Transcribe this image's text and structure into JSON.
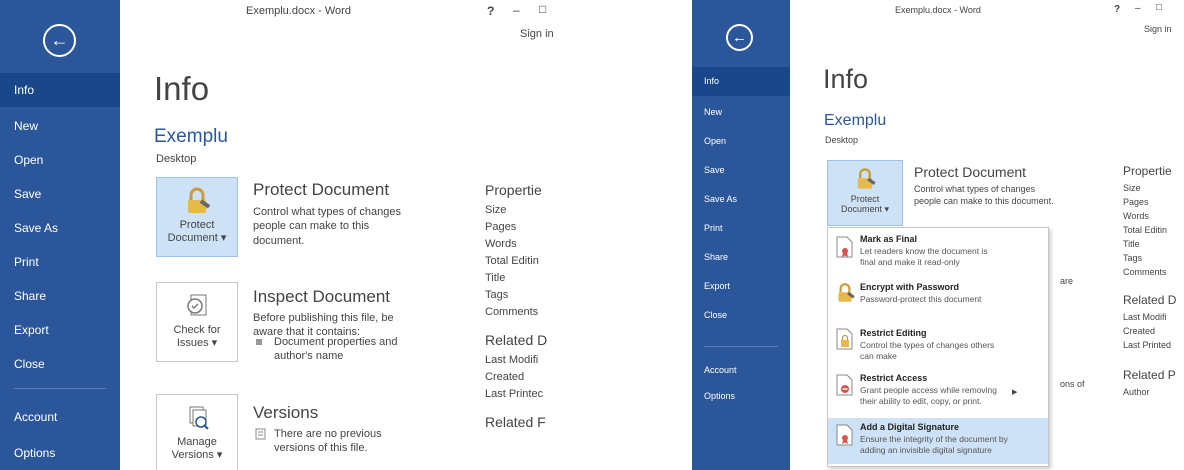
{
  "window": {
    "title": "Exemplu.docx - Word",
    "help": "?",
    "minimize": "–",
    "restore": "□",
    "signin": "Sign in"
  },
  "backstage": {
    "back_icon": "back-arrow-icon",
    "nav": [
      "Info",
      "New",
      "Open",
      "Save",
      "Save As",
      "Print",
      "Share",
      "Export",
      "Close",
      "Account",
      "Options"
    ],
    "active": "Info"
  },
  "info": {
    "title": "Info",
    "doc_name": "Exemplu",
    "doc_location": "Desktop",
    "protect": {
      "tile_line1": "Protect",
      "tile_line2": "Document ▾",
      "title": "Protect Document",
      "desc": "Control what types of changes people can make to this document."
    },
    "inspect": {
      "tile_line1": "Check for",
      "tile_line2": "Issues ▾",
      "title": "Inspect Document",
      "desc": "Before publishing this file, be aware that it contains:",
      "bullet": "Document properties and author's name"
    },
    "versions": {
      "tile_line1": "Manage",
      "tile_line2": "Versions ▾",
      "title": "Versions",
      "desc": "There are no previous versions of this file."
    }
  },
  "properties": {
    "header": "Propertie",
    "items": [
      "Size",
      "Pages",
      "Words",
      "Total Editin",
      "Title",
      "Tags",
      "Comments"
    ],
    "related_dates_header": "Related D",
    "related_dates": [
      "Last Modifi",
      "Created",
      "Last Printec"
    ],
    "related_people_header": "Related F",
    "related_people": [
      "Author"
    ]
  },
  "right_panel": {
    "properties_header": "Propertie",
    "related_dates_header": "Related D",
    "related_people_header": "Related P",
    "partial_aware": "are",
    "partial_versions": "ons of",
    "related_dates": [
      "Last Modifi",
      "Created",
      "Last Printed"
    ]
  },
  "protect_menu": [
    {
      "title": "Mark as Final",
      "desc": "Let readers know the document is final and make it read-only",
      "icon": "mark-final-icon"
    },
    {
      "title": "Encrypt with Password",
      "desc": "Password-protect this document",
      "icon": "lock-key-icon"
    },
    {
      "title": "Restrict Editing",
      "desc": "Control the types of changes others can make",
      "icon": "restrict-editing-icon"
    },
    {
      "title": "Restrict Access",
      "desc": "Grant people access while removing their ability to edit, copy, or print.",
      "icon": "restrict-access-icon"
    },
    {
      "title": "Add a Digital Signature",
      "desc": "Ensure the integrity of the document by adding an invisible digital signature",
      "icon": "digital-signature-icon"
    }
  ],
  "colors": {
    "sidebar": "#2b579a",
    "sidebar_active": "#19478a",
    "accent_text": "#2b579a",
    "highlight": "#cde2f7"
  }
}
